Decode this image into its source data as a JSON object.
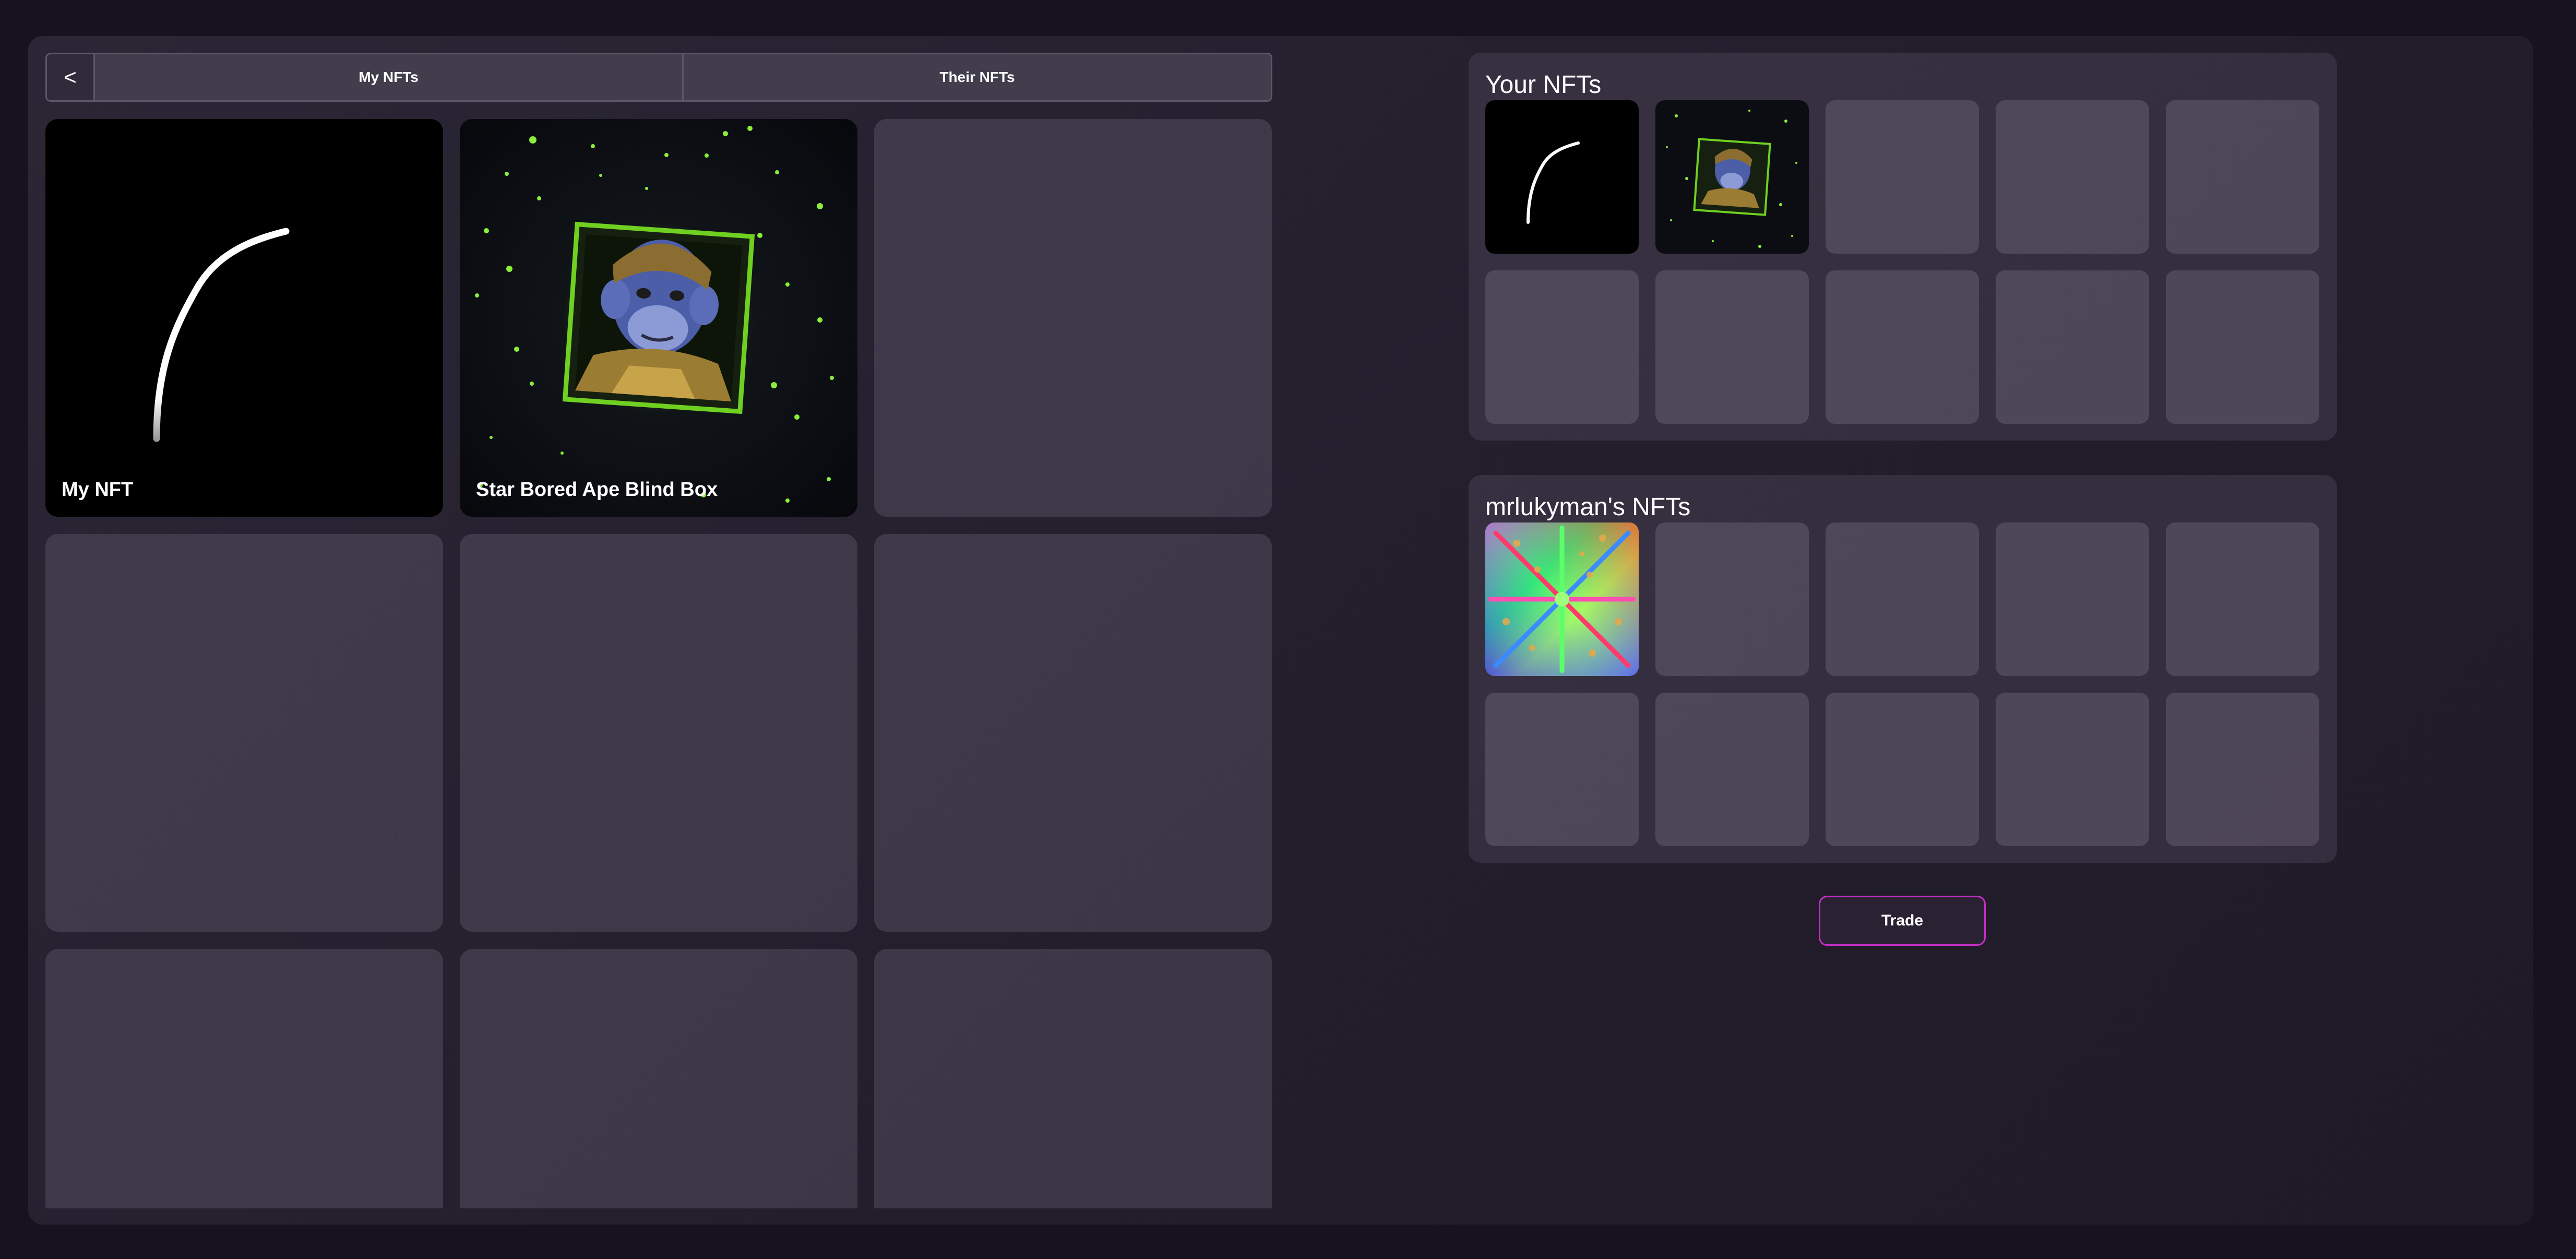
{
  "tabs": {
    "back_label": "<",
    "my_nfts": "My NFTs",
    "their_nfts": "Their NFTs"
  },
  "gallery": {
    "items": [
      {
        "label": "My NFT",
        "icon": "curve-stroke-art"
      },
      {
        "label": "Star Bored Ape Blind Box",
        "icon": "ape-portrait-art"
      }
    ]
  },
  "your_nfts": {
    "title": "Your NFTs"
  },
  "their_nfts_section": {
    "title": "mrlukyman's NFTs"
  },
  "trade": {
    "label": "Trade"
  },
  "colors": {
    "background": "#16121f",
    "panel": "#262130",
    "card": "#3f3a49",
    "accent": "#c42fc6"
  }
}
